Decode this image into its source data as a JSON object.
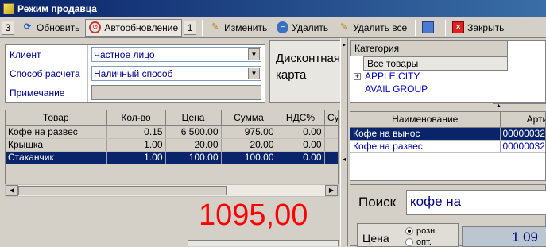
{
  "window": {
    "title": "Режим продавца"
  },
  "toolbar": {
    "counter_left": "3",
    "refresh_label": "Обновить",
    "auto_label": "Автообновление",
    "auto_count": "1",
    "edit_label": "Изменить",
    "delete_label": "Удалить",
    "delete_all_label": "Удалить все",
    "close_label": "Закрыть"
  },
  "form": {
    "client_label": "Клиент",
    "client_value": "Частное лицо",
    "payment_label": "Способ расчета",
    "payment_value": "Наличный способ",
    "note_label": "Примечание",
    "note_value": ""
  },
  "discount_card": {
    "line1": "Дисконтная",
    "line2": "карта"
  },
  "cart": {
    "columns": [
      "Товар",
      "Кол-во",
      "Цена",
      "Сумма",
      "НДС%",
      "Сумм"
    ],
    "rows": [
      [
        "Кофе на развес",
        "0.15",
        "6 500.00",
        "975.00",
        "0.00",
        ""
      ],
      [
        "Крышка",
        "1.00",
        "20.00",
        "20.00",
        "0.00",
        ""
      ],
      [
        "Стаканчик",
        "1.00",
        "100.00",
        "100.00",
        "0.00",
        ""
      ]
    ],
    "selected_row": 2
  },
  "total": "1095,00",
  "category": {
    "header": "Категория",
    "all_label": "Все товары",
    "items": [
      "APPLE CITY",
      "AVAIL GROUP"
    ]
  },
  "products": {
    "columns": [
      "Наименование",
      "Артикул"
    ],
    "rows": [
      [
        "Кофе на вынос",
        "00000032"
      ],
      [
        "Кофе на развес",
        "00000032"
      ]
    ],
    "selected_row": 0
  },
  "search": {
    "label": "Поиск",
    "value": "кофе на"
  },
  "price": {
    "label": "Цена",
    "options": [
      "розн.",
      "опт."
    ],
    "selected": "розн.",
    "value": "1 09"
  }
}
